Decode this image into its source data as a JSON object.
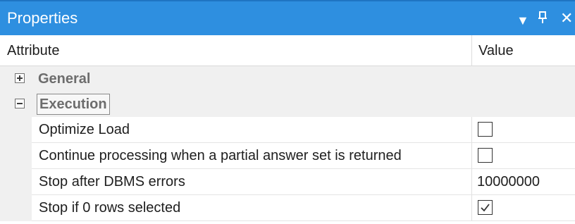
{
  "panel": {
    "title": "Properties",
    "controls": {
      "menu": "▼",
      "pin": "ᵖ",
      "close": "✕"
    }
  },
  "columns": {
    "attribute": "Attribute",
    "value": "Value"
  },
  "categories": [
    {
      "label": "General",
      "expanded": false,
      "toggle_icon": "plus-box-icon"
    },
    {
      "label": "Execution",
      "expanded": true,
      "toggle_icon": "minus-box-icon"
    }
  ],
  "properties": [
    {
      "name": "Optimize Load",
      "type": "checkbox",
      "checked": false
    },
    {
      "name": "Continue processing when a partial answer set is returned",
      "type": "checkbox",
      "checked": false
    },
    {
      "name": "Stop after DBMS errors",
      "type": "text",
      "value": "10000000"
    },
    {
      "name": "Stop if 0 rows selected",
      "type": "checkbox",
      "checked": true
    }
  ],
  "colors": {
    "titlebar": "#2e8fe0",
    "category_bg": "#f0f0f0",
    "category_text": "#6d6d6d"
  }
}
